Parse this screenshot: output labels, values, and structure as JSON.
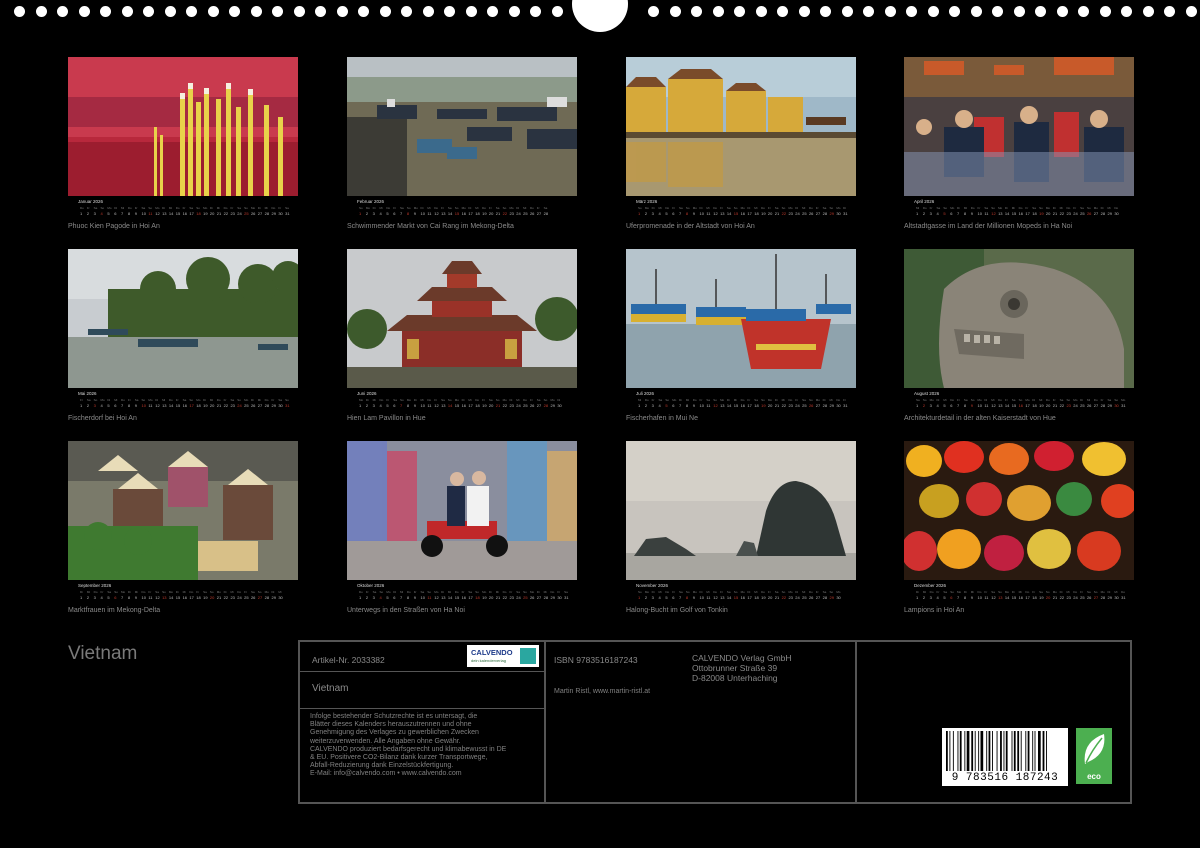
{
  "title": "Vietnam",
  "calendar": {
    "weekday_row": [
      "Mo",
      "Di",
      "Mi",
      "Do",
      "Fr",
      "Sa",
      "So",
      "Mo",
      "Di",
      "Mi",
      "Do",
      "Fr",
      "Sa",
      "So",
      "Mo",
      "Di",
      "Mi",
      "Do",
      "Fr",
      "Sa",
      "So",
      "Mo",
      "Di",
      "Mi",
      "Do",
      "Fr",
      "Sa",
      "So",
      "Mo",
      "Di",
      "Mi"
    ],
    "months": [
      {
        "name": "Januar 2026",
        "days": 31,
        "caption": "Phuoc Kien Pagode in Hoi An"
      },
      {
        "name": "Februar 2026",
        "days": 28,
        "caption": "Schwimmender Markt von Cai Rang im Mekong-Delta"
      },
      {
        "name": "März 2026",
        "days": 31,
        "caption": "Uferpromenade in der Altstadt von Hoi An"
      },
      {
        "name": "April 2026",
        "days": 30,
        "caption": "Altstadtgasse im Land der Millionen Mopeds in Ha Noi"
      },
      {
        "name": "Mai 2026",
        "days": 31,
        "caption": "Fischerdorf bei Hoi An"
      },
      {
        "name": "Juni 2026",
        "days": 30,
        "caption": "Hien Lam Pavillon in Hue"
      },
      {
        "name": "Juli 2026",
        "days": 31,
        "caption": "Fischerhafen in Mui Ne"
      },
      {
        "name": "August 2026",
        "days": 31,
        "caption": "Architekturdetail in der alten Kaiserstadt von Hue"
      },
      {
        "name": "September 2026",
        "days": 30,
        "caption": "Marktfrauen im Mekong-Delta"
      },
      {
        "name": "Oktober 2026",
        "days": 31,
        "caption": "Unterwegs in den Straßen von Ha Noi"
      },
      {
        "name": "November 2026",
        "days": 30,
        "caption": "Halong-Bucht im Golf von Tonkin"
      },
      {
        "name": "Dezember 2026",
        "days": 31,
        "caption": "Lampions in Hoi An"
      }
    ]
  },
  "info": {
    "article": "Artikel-Nr. 2033382",
    "calendar_title": "Vietnam",
    "legal": [
      "Infolge bestehender Schutzrechte ist es untersagt, die",
      "Blätter dieses Kalenders herauszutrennen und ohne",
      "Genehmigung des Verlages zu gewerblichen Zwecken",
      "weiterzuverwenden. Alle Angaben ohne Gewähr.",
      "CALVENDO produziert bedarfsgerecht und klimabewusst in DE",
      "& EU. Positivere CO2-Bilanz dank kurzer Transportwege,",
      "Abfall-Reduzierung dank Einzelstückfertigung.",
      "E-Mail: info@calvendo.com • www.calvendo.com"
    ],
    "isbn": "ISBN 9783516187243",
    "publisher": [
      "CALVENDO Verlag GmbH",
      "Ottobrunner Straße 39",
      "D-82008 Unterhaching"
    ],
    "author": "Martin Ristl, www.martin-ristl.at",
    "logo_name": "CALVENDO",
    "logo_tagline": "dein kalenderverlag",
    "barcode_number": "9   783516   187243",
    "eco_label": "eco"
  },
  "colors": {
    "background": "#000000",
    "text": "#8a8a8a",
    "border": "#555555",
    "sunday": "#c0392b"
  }
}
